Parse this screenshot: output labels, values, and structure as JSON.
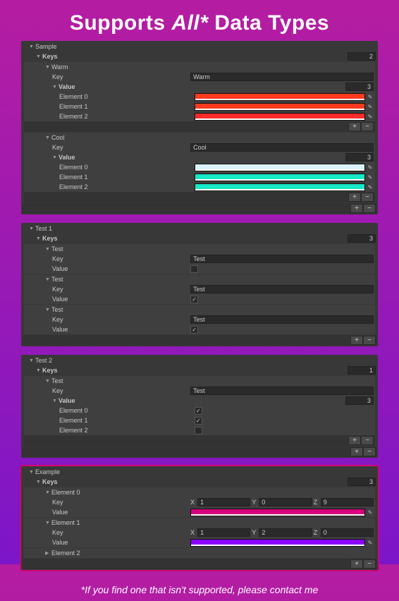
{
  "title_prefix": "Supports ",
  "title_em": "All*",
  "title_suffix": " Data Types",
  "footnote": "*If you find one that isn't supported, please contact me",
  "labels": {
    "keys": "Keys",
    "key": "Key",
    "value": "Value",
    "element": "Element"
  },
  "vec": {
    "x": "X",
    "y": "Y",
    "z": "Z"
  },
  "icons": {
    "eyedropper": "✎"
  },
  "panels": {
    "sample": {
      "name": "Sample",
      "keys_count": "2",
      "groups": [
        {
          "name": "Warm",
          "key_value": "Warm",
          "value_count": "3",
          "elements": [
            {
              "label": "Element 0",
              "color": "#ff3a1f"
            },
            {
              "label": "Element 1",
              "color": "#ff3a1f"
            },
            {
              "label": "Element 2",
              "color": "#ff2a2a"
            }
          ]
        },
        {
          "name": "Cool",
          "key_value": "Cool",
          "value_count": "3",
          "elements": [
            {
              "label": "Element 0",
              "color": "#d9f4ff"
            },
            {
              "label": "Element 1",
              "color": "#17e8c6"
            },
            {
              "label": "Element 2",
              "color": "#17e8c6"
            }
          ]
        }
      ]
    },
    "test1": {
      "name": "Test 1",
      "keys_count": "3",
      "items": [
        {
          "name": "Test",
          "key_value": "Test",
          "checked": false
        },
        {
          "name": "Test",
          "key_value": "Test",
          "checked": true
        },
        {
          "name": "Test",
          "key_value": "Test",
          "checked": true
        }
      ]
    },
    "test2": {
      "name": "Test 2",
      "keys_count": "1",
      "item": {
        "name": "Test",
        "key_value": "Test",
        "value_count": "3",
        "elements": [
          {
            "label": "Element 0",
            "checked": true
          },
          {
            "label": "Element 1",
            "checked": true
          },
          {
            "label": "Element 2",
            "checked": false
          }
        ]
      }
    },
    "example": {
      "name": "Example",
      "keys_count": "3",
      "items": [
        {
          "label": "Element 0",
          "vec": {
            "x": "1",
            "y": "0",
            "z": "9"
          },
          "color": "#d6007a"
        },
        {
          "label": "Element 1",
          "vec": {
            "x": "1",
            "y": "2",
            "z": "0"
          },
          "color": "#8a00ff"
        },
        {
          "label": "Element 2"
        }
      ]
    }
  }
}
